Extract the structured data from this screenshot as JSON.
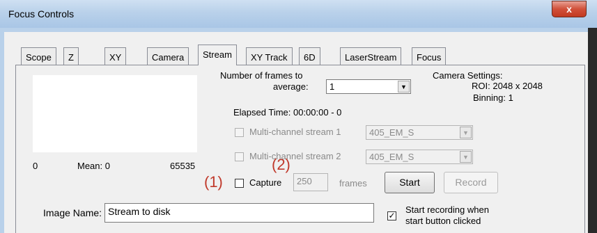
{
  "window": {
    "title": "Focus Controls",
    "close_symbol": "x"
  },
  "tabs": [
    {
      "label": "Scope",
      "active": false
    },
    {
      "label": "Z",
      "active": false
    },
    {
      "label": "XY",
      "active": false
    },
    {
      "label": "Camera",
      "active": false
    },
    {
      "label": "Stream",
      "active": true
    },
    {
      "label": "XY Track",
      "active": false
    },
    {
      "label": "6D",
      "active": false
    },
    {
      "label": "LaserStream",
      "active": false
    },
    {
      "label": "Focus",
      "active": false
    }
  ],
  "histogram": {
    "min": "0",
    "mean": "Mean: 0",
    "max": "65535"
  },
  "frames": {
    "label_line1": "Number of frames to",
    "label_line2": "average:",
    "value": "1"
  },
  "camera_settings": {
    "title": "Camera Settings:",
    "roi": "ROI: 2048 x 2048",
    "binning": "Binning: 1"
  },
  "elapsed": {
    "text": "Elapsed Time:  00:00:00 - 0"
  },
  "multi1": {
    "label": "Multi-channel stream 1",
    "value": "405_EM_S"
  },
  "multi2": {
    "label": "Multi-channel stream 2",
    "value": "405_EM_S"
  },
  "capture": {
    "label": "Capture",
    "frames_value": "250",
    "frames_unit": "frames"
  },
  "buttons": {
    "start": "Start",
    "record": "Record"
  },
  "image_name": {
    "label": "Image Name:",
    "value": "Stream to disk"
  },
  "record_option": {
    "line1": "Start recording when",
    "line2": "start button clicked",
    "checked_symbol": "✓"
  },
  "annotations": {
    "one": "(1)",
    "two": "(2)"
  },
  "colors": {
    "annotation": "#c0392b",
    "titlebar": "#b9d1ea",
    "close": "#c23a20"
  }
}
